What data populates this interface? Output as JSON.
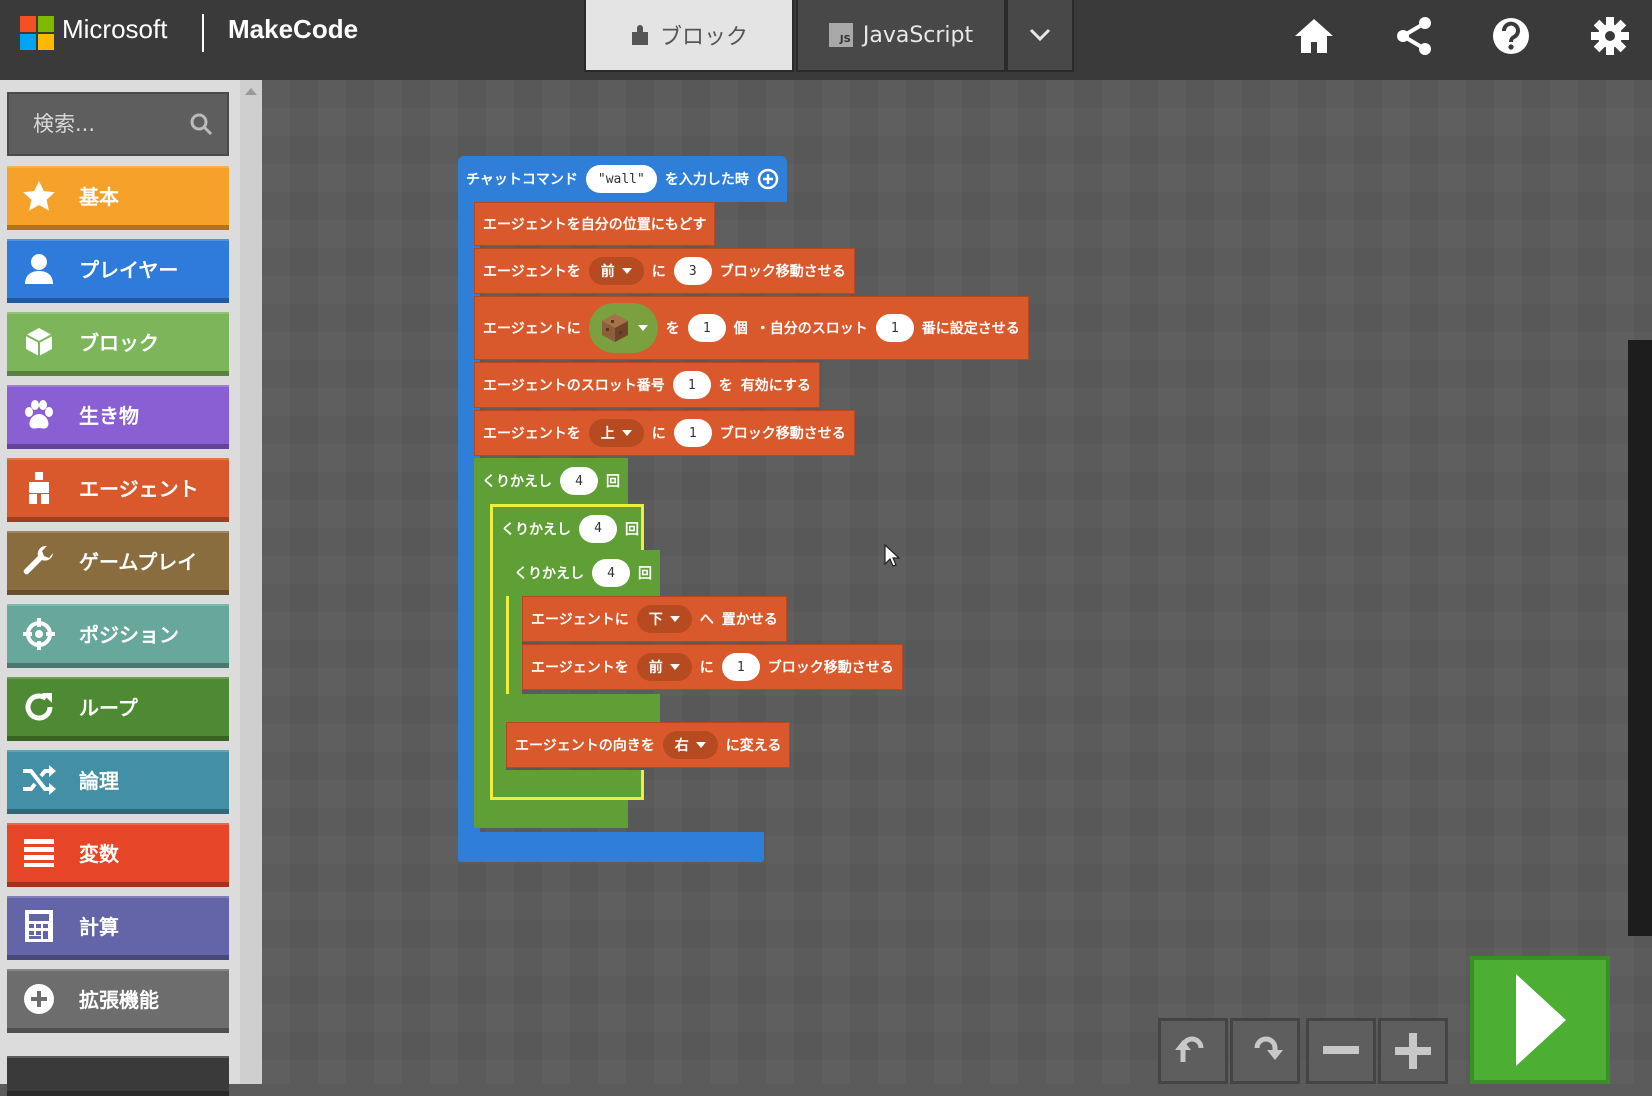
{
  "header": {
    "microsoft_label": "Microsoft",
    "product_label": "MakeCode",
    "tab_blocks": "ブロック",
    "tab_js": "JavaScript",
    "js_badge": "JS",
    "icons": [
      "home-icon",
      "share-icon",
      "help-icon",
      "settings-icon"
    ]
  },
  "toolbox": {
    "search_placeholder": "検索...",
    "categories": [
      {
        "label": "基本",
        "color": "#f5a12a",
        "icon": "star-icon"
      },
      {
        "label": "プレイヤー",
        "color": "#2e7bdc",
        "icon": "person-icon"
      },
      {
        "label": "ブロック",
        "color": "#7cb55a",
        "icon": "cube-icon"
      },
      {
        "label": "生き物",
        "color": "#8a5fd4",
        "icon": "paw-icon"
      },
      {
        "label": "エージェント",
        "color": "#d9592c",
        "icon": "agent-icon"
      },
      {
        "label": "ゲームプレイ",
        "color": "#8a6d3f",
        "icon": "wrench-icon"
      },
      {
        "label": "ポジション",
        "color": "#67a79c",
        "icon": "crosshair-icon"
      },
      {
        "label": "ループ",
        "color": "#4e8a33",
        "icon": "loop-icon"
      },
      {
        "label": "論理",
        "color": "#438fa6",
        "icon": "shuffle-icon"
      },
      {
        "label": "変数",
        "color": "#e64527",
        "icon": "list-icon"
      },
      {
        "label": "計算",
        "color": "#6465a8",
        "icon": "calculator-icon"
      },
      {
        "label": "拡張機能",
        "color": "#6d6d6d",
        "icon": "plus-circle-icon"
      }
    ]
  },
  "program": {
    "hat": {
      "prefix": "チャットコマンド",
      "command": "\"wall\"",
      "suffix": "を入力した時"
    },
    "b1": "エージェントを自分の位置にもどす",
    "b2": {
      "a": "エージェントを",
      "dir": "前",
      "b": "に",
      "n": "3",
      "c": "ブロック移動させる"
    },
    "b3": {
      "a": "エージェントに",
      "b": "を",
      "n1": "1",
      "c": "個",
      "d": "・自分のスロット",
      "n2": "1",
      "e": "番に設定させる"
    },
    "b4": {
      "a": "エージェントのスロット番号",
      "n": "1",
      "b": "を",
      "c": "有効にする"
    },
    "b5": {
      "a": "エージェントを",
      "dir": "上",
      "b": "に",
      "n": "1",
      "c": "ブロック移動させる"
    },
    "loop1": {
      "a": "くりかえし",
      "n": "4",
      "b": "回"
    },
    "loop2": {
      "a": "くりかえし",
      "n": "4",
      "b": "回"
    },
    "loop3": {
      "a": "くりかえし",
      "n": "4",
      "b": "回"
    },
    "b6": {
      "a": "エージェントに",
      "dir": "下",
      "b": "へ",
      "c": "置かせる"
    },
    "b7": {
      "a": "エージェントを",
      "dir": "前",
      "b": "に",
      "n": "1",
      "c": "ブロック移動させる"
    },
    "b8": {
      "a": "エージェントの向きを",
      "dir": "右",
      "b": "に変える"
    }
  },
  "controls": {
    "icons": [
      "undo-icon",
      "redo-icon",
      "zoom-out-icon",
      "zoom-in-icon",
      "run-icon"
    ]
  }
}
